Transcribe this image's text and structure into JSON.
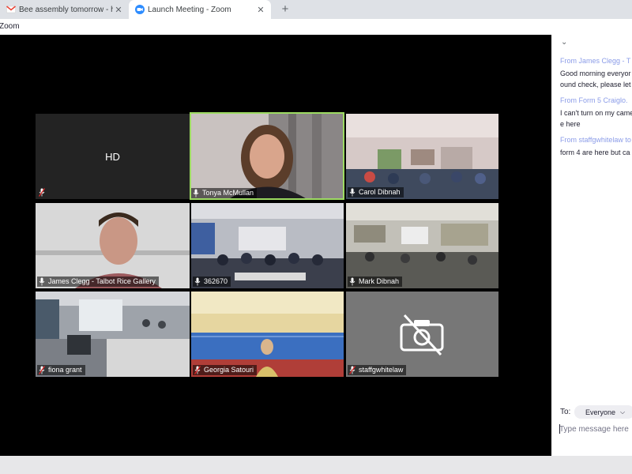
{
  "browser": {
    "tabs": [
      {
        "title": "Bee assembly tomorrow - hanna",
        "favicon": "gmail-icon",
        "close": "✕"
      },
      {
        "title": "Launch Meeting - Zoom",
        "favicon": "zoom-icon",
        "close": "✕",
        "active": true
      }
    ],
    "new_tab": "+"
  },
  "app": {
    "title": "Zoom"
  },
  "gallery": {
    "tiles": [
      {
        "name": "",
        "label": "HD",
        "muted": true,
        "type": "placeholder"
      },
      {
        "name": "Tonya McMullan",
        "muted": false,
        "speaking": true,
        "type": "person"
      },
      {
        "name": "Carol Dibnah",
        "muted": false,
        "type": "classroom"
      },
      {
        "name": "James Clegg - Talbot Rice Gallery",
        "muted": false,
        "type": "person"
      },
      {
        "name": "362670",
        "muted": false,
        "type": "classroom"
      },
      {
        "name": "Mark Dibnah",
        "muted": false,
        "type": "classroom"
      },
      {
        "name": "fiona grant",
        "muted": true,
        "type": "classroom"
      },
      {
        "name": "Georgia Satouri",
        "muted": true,
        "type": "hall"
      },
      {
        "name": "staffgwhitelaw",
        "muted": true,
        "type": "camera-off"
      }
    ]
  },
  "chat": {
    "collapse_icon": "⌄",
    "messages": [
      {
        "from": "From James Clegg - T",
        "lines": [
          "Good morning everyor",
          "ound check, please let"
        ]
      },
      {
        "from": "From Form 5 Craiglo.",
        "lines": [
          "I can't turn on my came",
          "e here"
        ]
      },
      {
        "from": "From staffgwhitelaw to",
        "lines": [
          "form 4 are here but ca"
        ]
      }
    ],
    "to_label": "To:",
    "to_value": "Everyone",
    "input_placeholder": "Type message here"
  },
  "colors": {
    "speaker_border": "#9ddb62",
    "muted_icon": "#e02828",
    "chat_sender": "#8b9ce8"
  }
}
